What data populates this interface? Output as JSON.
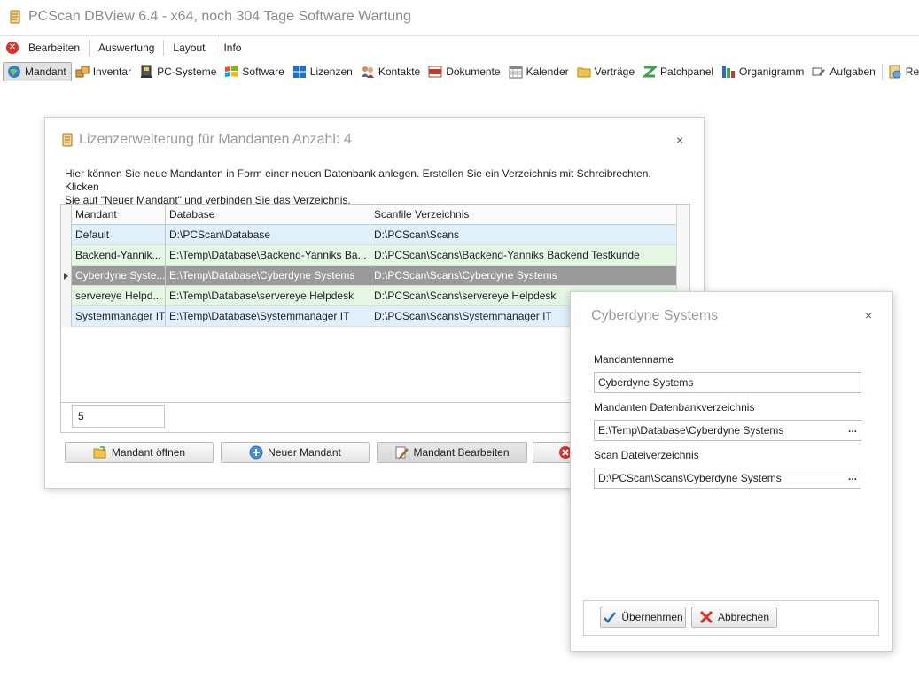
{
  "window": {
    "title": "PCScan DBView 6.4 - x64, noch 304 Tage Software Wartung"
  },
  "menu": {
    "items": [
      "Bearbeiten",
      "Auswertung",
      "Layout",
      "Info"
    ]
  },
  "toolbar": {
    "items": [
      {
        "label": "Mandant",
        "icon": "globe-icon"
      },
      {
        "label": "Inventar",
        "icon": "boxes-icon"
      },
      {
        "label": "PC-Systeme",
        "icon": "computer-icon"
      },
      {
        "label": "Software",
        "icon": "windows-flag-icon"
      },
      {
        "label": "Lizenzen",
        "icon": "windows-logo-icon"
      },
      {
        "label": "Kontakte",
        "icon": "people-icon"
      },
      {
        "label": "Dokumente",
        "icon": "pdf-icon"
      },
      {
        "label": "Kalender",
        "icon": "calendar-icon"
      },
      {
        "label": "Verträge",
        "icon": "folder-icon"
      },
      {
        "label": "Patchpanel",
        "icon": "patchpanel-icon"
      },
      {
        "label": "Organigramm",
        "icon": "org-chart-icon"
      },
      {
        "label": "Aufgaben",
        "icon": "tasks-icon"
      },
      {
        "label": "Remote",
        "icon": "remote-icon"
      }
    ]
  },
  "main_dialog": {
    "title": "Lizenzerweiterung für Mandanten Anzahl: 4",
    "description_line1": "Hier können Sie neue Mandanten in Form einer neuen Datenbank anlegen. Erstellen Sie ein Verzeichnis mit Schreibrechten. Klicken",
    "description_line2": "Sie auf \"Neuer Mandant\" und verbinden Sie das Verzeichnis.",
    "columns": [
      "Mandant",
      "Database",
      "Scanfile Verzeichnis"
    ],
    "rows": [
      [
        "Default",
        "D:\\PCScan\\Database",
        "D:\\PCScan\\Scans"
      ],
      [
        "Backend-Yannik...",
        "E:\\Temp\\Database\\Backend-Yanniks Ba...",
        "D:\\PCScan\\Scans\\Backend-Yanniks Backend Testkunde"
      ],
      [
        "Cyberdyne Syste...",
        "E:\\Temp\\Database\\Cyberdyne Systems",
        "D:\\PCScan\\Scans\\Cyberdyne Systems"
      ],
      [
        "servereye Helpd...",
        "E:\\Temp\\Database\\servereye Helpdesk",
        "D:\\PCScan\\Scans\\servereye Helpdesk"
      ],
      [
        "Systemmanager IT",
        "E:\\Temp\\Database\\Systemmanager IT",
        "D:\\PCScan\\Scans\\Systemmanager IT"
      ]
    ],
    "row_count": "5",
    "buttons": {
      "open": "Mandant öffnen",
      "new": "Neuer Mandant",
      "edit": "Mandant Bearbeiten"
    }
  },
  "edit_dialog": {
    "title": "Cyberdyne Systems",
    "name_label": "Mandantenname",
    "name_value": "Cyberdyne Systems",
    "db_label": "Mandanten Datenbankverzeichnis",
    "db_value": "E:\\Temp\\Database\\Cyberdyne Systems",
    "scan_label": "Scan Dateiverzeichnis",
    "scan_value": "D:\\PCScan\\Scans\\Cyberdyne Systems",
    "browse_label": "...",
    "ok_label": "Übernehmen",
    "cancel_label": "Abbrechen",
    "close_glyph": "×"
  }
}
